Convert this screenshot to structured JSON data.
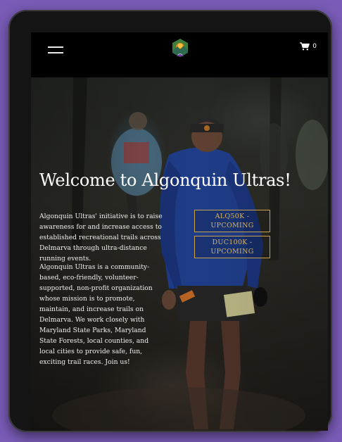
{
  "header": {
    "cart_count": "0"
  },
  "hero": {
    "title": "Welcome to Algonquin Ultras!",
    "paragraph_1": "Algonquin Ultras' initiative is to raise awareness for and increase access to established recreational trails across Delmarva through ultra-distance running events.",
    "paragraph_2": "Algonquin Ultras is a community-based, eco-friendly, volunteer-supported, non-profit organization whose mission is to promote, maintain, and increase trails on Delmarva. We work closely with Maryland State Parks, Maryland State Forests, local counties, and local cities to provide safe, fun, exciting trail races. Join us!",
    "race_buttons": [
      {
        "label": "ALQ50K - UPCOMING"
      },
      {
        "label": "DUC100K - UPCOMING"
      }
    ]
  },
  "colors": {
    "background": "#7a5cb8",
    "accent_gold": "#c9a24a",
    "header_bg": "#000000"
  },
  "icons": {
    "menu": "hamburger-icon",
    "logo": "algonquin-logo",
    "cart": "cart-icon"
  }
}
